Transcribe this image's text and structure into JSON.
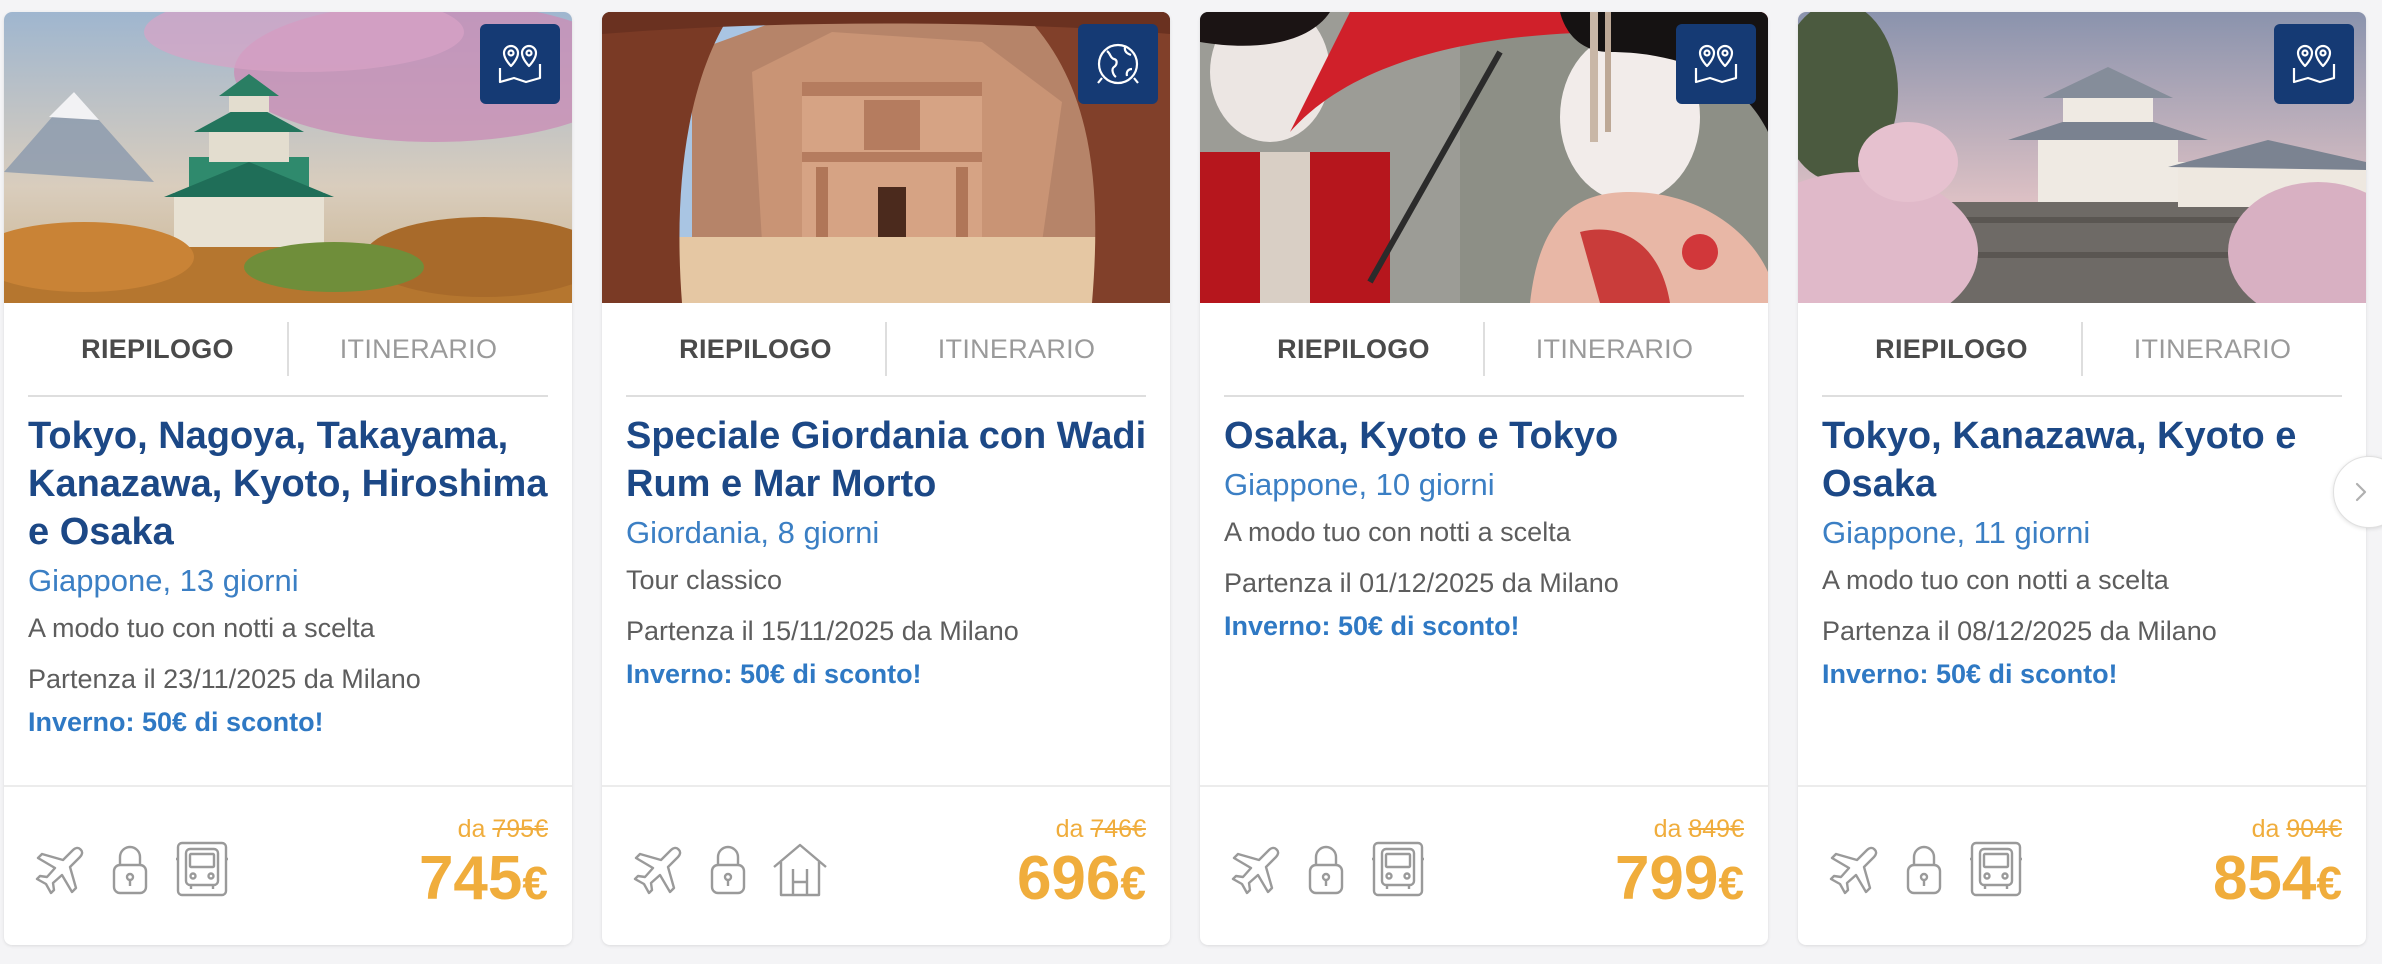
{
  "tabs": {
    "summary": "RIEPILOGO",
    "itinerary": "ITINERARIO"
  },
  "price_prefix": "da",
  "currency": "€",
  "colors": {
    "brand_navy": "#153a74",
    "title_blue": "#1c4886",
    "link_blue": "#3b7fc4",
    "price_orange": "#f0ad3c"
  },
  "cards": [
    {
      "badge_icon": "map-pins-icon",
      "title": "Tokyo, Nagoya, Takayama, Kanazawa, Kyoto, Hiroshima e Osaka",
      "subtitle": "Giappone, 13 giorni",
      "description": "A modo tuo con notti a scelta",
      "departure": "Partenza il 23/11/2025 da Milano",
      "promo": "Inverno: 50€ di sconto!",
      "old_price": "795€",
      "price": "745",
      "features": [
        "plane-icon",
        "lock-icon",
        "bus-icon"
      ]
    },
    {
      "badge_icon": "globe-icon",
      "title": "Speciale Giordania con Wadi Rum e Mar Morto",
      "subtitle": "Giordania, 8 giorni",
      "description": "Tour classico",
      "departure": "Partenza il 15/11/2025 da Milano",
      "promo": "Inverno: 50€ di sconto!",
      "old_price": "746€",
      "price": "696",
      "features": [
        "plane-icon",
        "lock-icon",
        "hotel-icon"
      ]
    },
    {
      "badge_icon": "map-pins-icon",
      "title": "Osaka, Kyoto e Tokyo",
      "subtitle": "Giappone, 10 giorni",
      "description": "A modo tuo con notti a scelta",
      "departure": "Partenza il 01/12/2025 da Milano",
      "promo": "Inverno: 50€ di sconto!",
      "old_price": "849€",
      "price": "799",
      "features": [
        "plane-icon",
        "lock-icon",
        "bus-icon"
      ]
    },
    {
      "badge_icon": "map-pins-icon",
      "title": "Tokyo, Kanazawa, Kyoto e Osaka",
      "subtitle": "Giappone, 11 giorni",
      "description": "A modo tuo con notti a scelta",
      "departure": "Partenza il 08/12/2025 da Milano",
      "promo": "Inverno: 50€ di sconto!",
      "old_price": "904€",
      "price": "854",
      "features": [
        "plane-icon",
        "lock-icon",
        "bus-icon"
      ]
    }
  ]
}
